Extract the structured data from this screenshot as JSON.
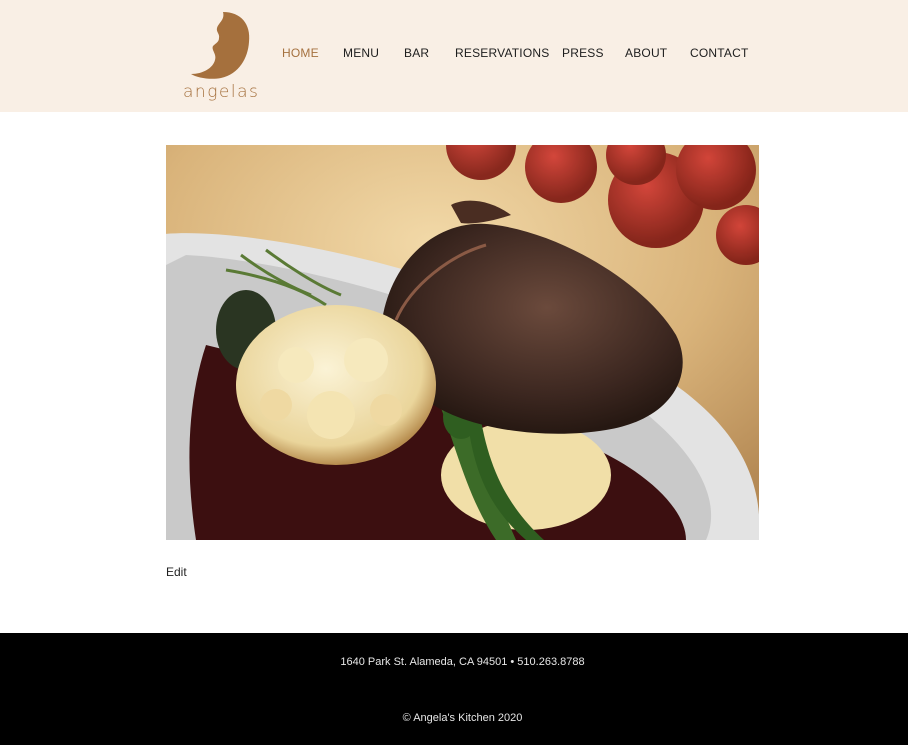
{
  "header": {
    "logo_text": "angelas",
    "brand_color": "#a5703d",
    "background_color": "#f9efe5"
  },
  "nav": {
    "items": [
      {
        "label": "HOME",
        "active": true
      },
      {
        "label": "MENU",
        "active": false
      },
      {
        "label": "BAR",
        "active": false
      },
      {
        "label": "RESERVATIONS",
        "active": false
      },
      {
        "label": "PRESS",
        "active": false
      },
      {
        "label": "ABOUT",
        "active": false
      },
      {
        "label": "CONTACT",
        "active": false
      }
    ],
    "active_color": "#a5713f"
  },
  "main": {
    "hero_image": "steak-cauliflower-dish-photo",
    "edit_link": "Edit"
  },
  "footer": {
    "address": "1640 Park St. Alameda, CA 94501 • 510.263.8788",
    "copyright": "© Angela's Kitchen 2020",
    "background_color": "#000000"
  }
}
